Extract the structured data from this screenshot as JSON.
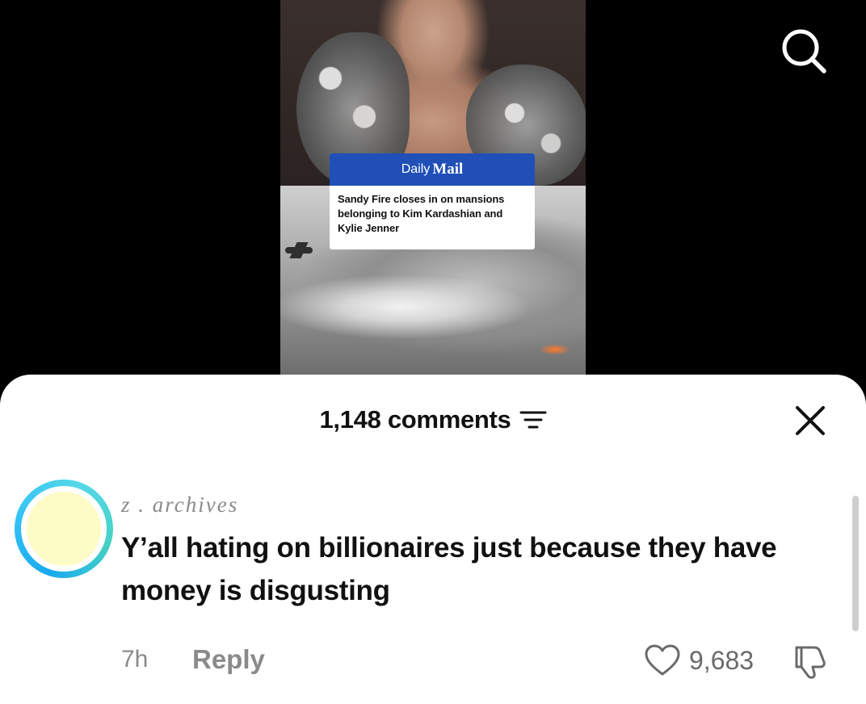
{
  "post": {
    "news_brand_part1": "Daily",
    "news_brand_part2": "Mail",
    "headline": "Sandy Fire closes in on mansions belonging to Kim Kardashian and Kylie Jenner"
  },
  "comments_panel": {
    "count_label": "1,148 comments"
  },
  "comment": {
    "username": "z . archives",
    "text": "Y’all hating on billionaires just because they have money is disgusting",
    "time": "7h",
    "reply_label": "Reply",
    "likes": "9,683"
  },
  "icons": {
    "search": "search-icon",
    "sort": "sort-filter-icon",
    "close": "close-icon",
    "like": "heart-icon",
    "dislike": "thumbs-down-icon"
  },
  "colors": {
    "sheet_bg": "#ffffff",
    "brand_blue": "#1f4fb7",
    "avatar_ring": "#35c4f5",
    "muted_text": "#8a8a8a"
  }
}
